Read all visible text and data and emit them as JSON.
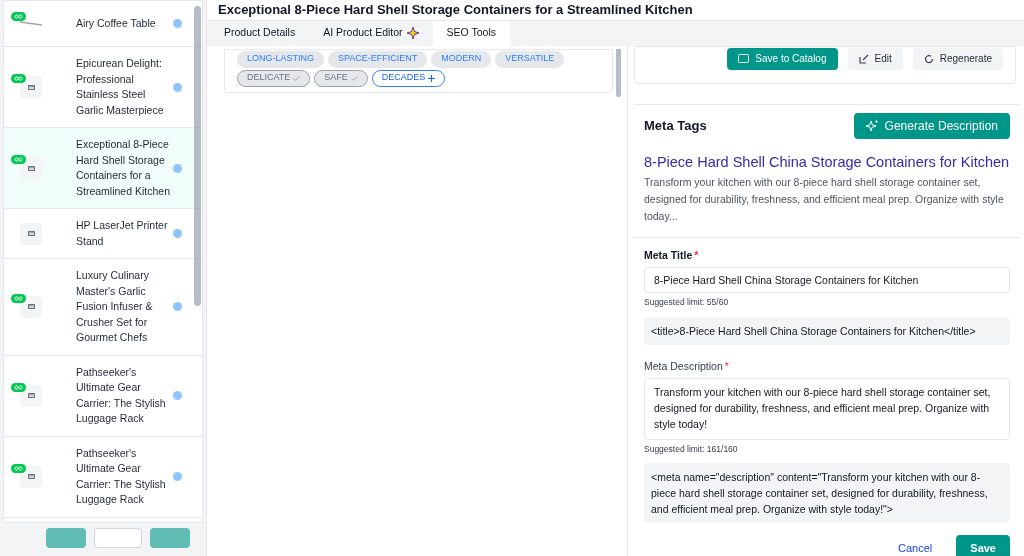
{
  "sidebar": {
    "items": [
      {
        "title": "Airy Coffee Table",
        "linked": true,
        "kind": "photo",
        "selected": false
      },
      {
        "title": "Epicurean Delight: Professional Stainless Steel Garlic Masterpiece",
        "linked": true,
        "kind": "placeholder",
        "selected": false
      },
      {
        "title": "Exceptional 8-Piece Hard Shell Storage Containers for a Streamlined Kitchen",
        "linked": true,
        "kind": "placeholder",
        "selected": true
      },
      {
        "title": "HP LaserJet Printer Stand",
        "linked": false,
        "kind": "placeholder",
        "selected": false
      },
      {
        "title": "Luxury Culinary Master's Garlic Fusion Infuser & Crusher Set for Gourmet Chefs",
        "linked": true,
        "kind": "placeholder",
        "selected": false
      },
      {
        "title": "Pathseeker's Ultimate Gear Carrier: The Stylish Luggage Rack",
        "linked": true,
        "kind": "placeholder",
        "selected": false
      },
      {
        "title": "Pathseeker's Ultimate Gear Carrier: The Stylish Luggage Rack",
        "linked": true,
        "kind": "placeholder",
        "selected": false
      }
    ]
  },
  "product_title": "Exceptional 8-Piece Hard Shell Storage Containers for a Streamlined Kitchen",
  "tabs": [
    {
      "label": "Product Details",
      "selected": false,
      "sparkle": false
    },
    {
      "label": "AI Product Editor",
      "selected": false,
      "sparkle": true
    },
    {
      "label": "SEO Tools",
      "selected": true,
      "sparkle": false
    }
  ],
  "keywords": [
    {
      "label": "LONG-LASTING",
      "kind": "suggested"
    },
    {
      "label": "SPACE-EFFICIENT",
      "kind": "suggested"
    },
    {
      "label": "MODERN",
      "kind": "suggested"
    },
    {
      "label": "VERSATILE",
      "kind": "suggested"
    },
    {
      "label": "DELICATE",
      "kind": "used"
    },
    {
      "label": "SAFE",
      "kind": "used"
    },
    {
      "label": "DECADES",
      "kind": "add"
    }
  ],
  "actions": [
    {
      "label": "Save to Catalog",
      "kind": "primary"
    },
    {
      "label": "Edit",
      "kind": "edit"
    },
    {
      "label": "Regenerate",
      "kind": "regenerate"
    }
  ],
  "meta_tags": {
    "heading": "Meta Tags",
    "generate_button": "Generate Description",
    "preview": {
      "title": "8-Piece Hard Shell China Storage Containers for Kitchen",
      "description": "Transform your kitchen with our 8-piece hard shell storage container set, designed for durability, freshness, and efficient meal prep. Organize with style today..."
    },
    "meta_title": {
      "label": "Meta Title",
      "required_mark": "*",
      "value": "8-Piece Hard Shell China Storage Containers for Kitchen",
      "hint": "Suggested limit: 55/60",
      "code": "<title>8-Piece Hard Shell China Storage Containers for Kitchen</title>"
    },
    "meta_description": {
      "label": "Meta Description",
      "required_mark": "*",
      "value": "Transform your kitchen with our 8-piece hard shell storage container set, designed for durability, freshness, and efficient meal prep. Organize with style today!",
      "hint": "Suggested limit: 161/160",
      "code": "<meta name=\"description\" content=\"Transform your kitchen with our 8-piece hard shell storage container set, designed for durability, freshness, and efficient meal prep. Organize with style today!\">"
    },
    "cancel": "Cancel",
    "save": "Save"
  }
}
